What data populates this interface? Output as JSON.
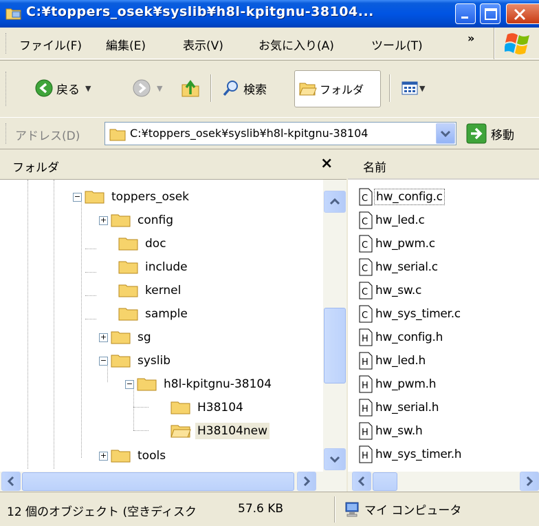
{
  "window": {
    "title": "C:¥toppers_osek¥syslib¥h8l-kpitgnu-38104...",
    "icons": {
      "app": "folder-window-icon",
      "minimize": "minimize-icon",
      "maximize": "maximize-icon",
      "close": "close-icon"
    }
  },
  "menubar": {
    "items": [
      {
        "label": "ファイル(F)"
      },
      {
        "label": "編集(E)"
      },
      {
        "label": "表示(V)"
      },
      {
        "label": "お気に入り(A)"
      },
      {
        "label": "ツール(T)"
      }
    ],
    "overflow": "»"
  },
  "toolbar": {
    "back_label": "戻る",
    "search_label": "検索",
    "folders_label": "フォルダ"
  },
  "address": {
    "label": "アドレス(D)",
    "path": "C:¥toppers_osek¥syslib¥h8l-kpitgnu-38104",
    "go_label": "移動"
  },
  "folder_pane": {
    "header": "フォルダ",
    "close": "×",
    "tree": [
      {
        "label": "toppers_osek",
        "expander": "−"
      },
      {
        "label": "config",
        "expander": "+"
      },
      {
        "label": "doc",
        "expander": ""
      },
      {
        "label": "include",
        "expander": ""
      },
      {
        "label": "kernel",
        "expander": ""
      },
      {
        "label": "sample",
        "expander": ""
      },
      {
        "label": "sg",
        "expander": "+"
      },
      {
        "label": "syslib",
        "expander": "−"
      },
      {
        "label": "h8l-kpitgnu-38104",
        "expander": "−"
      },
      {
        "label": "H38104",
        "expander": ""
      },
      {
        "label": "H38104new",
        "expander": "",
        "selected": true
      },
      {
        "label": "tools",
        "expander": "+"
      }
    ]
  },
  "file_pane": {
    "column_name": "名前",
    "files": [
      {
        "name": "hw_config.c",
        "type": "C"
      },
      {
        "name": "hw_led.c",
        "type": "C"
      },
      {
        "name": "hw_pwm.c",
        "type": "C"
      },
      {
        "name": "hw_serial.c",
        "type": "C"
      },
      {
        "name": "hw_sw.c",
        "type": "C"
      },
      {
        "name": "hw_sys_timer.c",
        "type": "C"
      },
      {
        "name": "hw_config.h",
        "type": "H"
      },
      {
        "name": "hw_led.h",
        "type": "H"
      },
      {
        "name": "hw_pwm.h",
        "type": "H"
      },
      {
        "name": "hw_serial.h",
        "type": "H"
      },
      {
        "name": "hw_sw.h",
        "type": "H"
      },
      {
        "name": "hw_sys_timer.h",
        "type": "H"
      }
    ]
  },
  "statusbar": {
    "objects": "12 個のオブジェクト (空きディスク",
    "size": "57.6 KB",
    "zone": "マイ コンピュータ"
  }
}
